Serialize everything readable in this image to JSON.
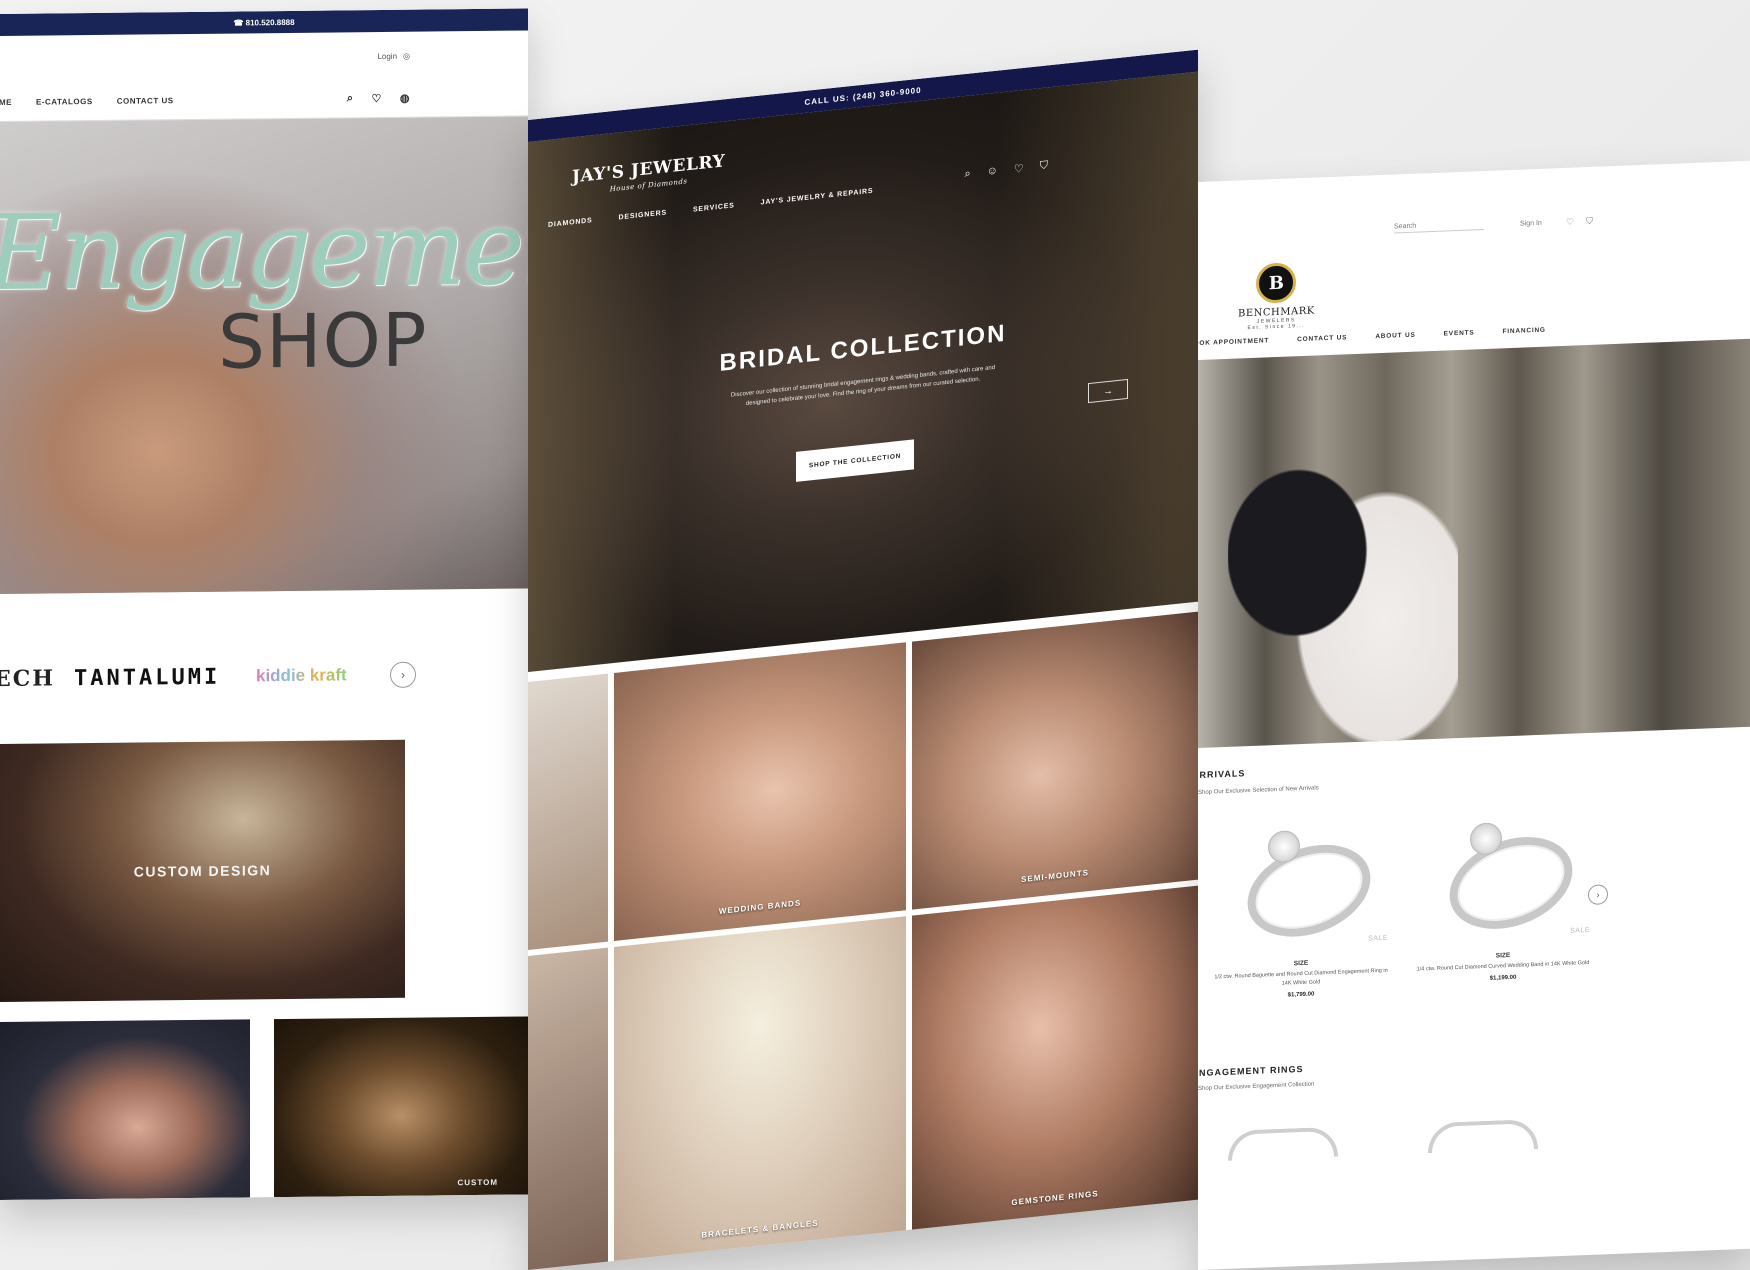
{
  "left": {
    "topbar_phone": "☎ 810.520.8888",
    "login": "Login",
    "nav": [
      "HOME",
      "E-CATALOGS",
      "CONTACT US"
    ],
    "hero_script": "Engagement",
    "hero_word": "SHOP",
    "brand_logos": [
      "ECH",
      "TANTALUMI",
      "kiddie kraft"
    ],
    "custom_label": "CUSTOM DESIGN",
    "tile_caption": "CUSTOM"
  },
  "middle": {
    "topbar": "CALL US: (248) 360-9000",
    "brand": "JAY'S JEWELRY",
    "brand_tag": "House of Diamonds",
    "nav": [
      "DIAMONDS",
      "DESIGNERS",
      "SERVICES",
      "JAY'S JEWELRY & REPAIRS"
    ],
    "hero_title": "BRIDAL COLLECTION",
    "hero_desc": "Discover our collection of stunning bridal engagement rings & wedding bands, crafted with care and designed to celebrate your love. Find the ring of your dreams from our curated selection.",
    "hero_button": "SHOP THE COLLECTION",
    "tiles": [
      "",
      "WEDDING BANDS",
      "SEMI-MOUNTS",
      "",
      "BRACELETS & BANGLES",
      "GEMSTONE RINGS"
    ]
  },
  "right": {
    "search_placeholder": "Search",
    "sign_in": "Sign In",
    "brand": "BENCHMARK",
    "brand_sub": "JEWELERS",
    "brand_tag": "Est. Since 19...",
    "nav": [
      "BOOK APPOINTMENT",
      "CONTACT US",
      "ABOUT US",
      "EVENTS",
      "FINANCING"
    ],
    "section1": "ARRIVALS",
    "section1_sub": "Shop Our Exclusive Selection of New Arrivals",
    "products": [
      {
        "label": "SIZE",
        "title": "1/2 ctw. Round Baguette and Round Cut Diamond Engagement Ring in 14K White Gold",
        "price": "$1,799.00",
        "badge": "SALE"
      },
      {
        "label": "SIZE",
        "title": "1/4 ctw. Round Cut Diamond Curved Wedding Band in 14K White Gold",
        "price": "$1,199.00",
        "badge": "SALE"
      }
    ],
    "section2": "ENGAGEMENT RINGS",
    "section2_sub": "Shop Our Exclusive Engagement Collection"
  },
  "colors": {
    "navy": "#182556",
    "mint_script": "#9fcdbd",
    "gold": "#d6b24a"
  }
}
